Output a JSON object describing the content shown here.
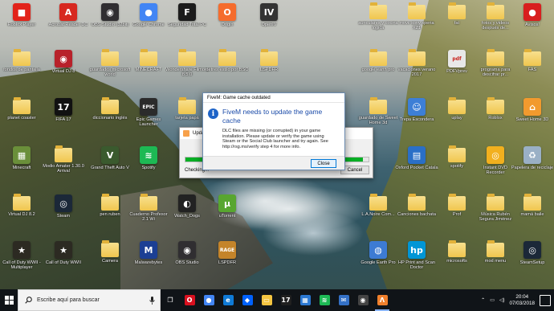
{
  "desktop": {
    "icons": [
      {
        "label": "Roblox Player",
        "glyph": "■",
        "color": "#e2231a",
        "kind": "app"
      },
      {
        "label": "Acrobat Reader DC",
        "glyph": "A",
        "color": "#d7281f",
        "kind": "app"
      },
      {
        "label": "OBS Studio (32bit)",
        "glyph": "◉",
        "color": "#302e31",
        "kind": "app"
      },
      {
        "label": "Google Chrome",
        "glyph": "●",
        "color": "#4285f4",
        "kind": "app"
      },
      {
        "label": "Seguridad Total PC",
        "glyph": "F",
        "color": "#1c1c1c",
        "kind": "app"
      },
      {
        "label": "Origin",
        "glyph": "O",
        "color": "#f56c2d",
        "kind": "app"
      },
      {
        "label": "OpenIV",
        "glyph": "IV",
        "color": "#333333",
        "kind": "app"
      },
      {
        "label": "fondos de pantalla",
        "kind": "folder"
      },
      {
        "label": "Virtual DJ 8",
        "glyph": "◉",
        "color": "#b8212a",
        "kind": "app"
      },
      {
        "label": "guardados microsoft world",
        "kind": "folder"
      },
      {
        "label": "MINECRAFT",
        "kind": "folder"
      },
      {
        "label": "Wondershare Filmora 8.5.0",
        "kind": "folder"
      },
      {
        "label": "detres estilo por BSO",
        "kind": "folder"
      },
      {
        "label": "LSPDFR",
        "kind": "folder"
      },
      {
        "label": "planet coaster",
        "kind": "folder"
      },
      {
        "label": "FIFA 17",
        "glyph": "17",
        "color": "#111111",
        "kind": "app"
      },
      {
        "label": "diccionario inglés",
        "kind": "folder"
      },
      {
        "label": "Epic Games Launcher",
        "glyph": "EPIC",
        "color": "#2b2b2b",
        "kind": "app"
      },
      {
        "label": "tarjeta papá",
        "kind": "folder"
      },
      {
        "label": "Minecraft",
        "glyph": "▦",
        "color": "#6a8f3a",
        "kind": "app"
      },
      {
        "label": "Modio Amater 1.30.0 Arrival",
        "kind": "folder"
      },
      {
        "label": "Grand Theft Auto V",
        "glyph": "V",
        "color": "#3a5a2e",
        "kind": "app"
      },
      {
        "label": "Spotify",
        "glyph": "≋",
        "color": "#1db954",
        "kind": "app"
      },
      {
        "label": "Virtual DJ 8.2",
        "kind": "folder"
      },
      {
        "label": "Steam",
        "glyph": "◎",
        "color": "#1b2838",
        "kind": "app"
      },
      {
        "label": "pen ruben",
        "kind": "folder"
      },
      {
        "label": "Cuaderno Profesor 2.1 Wi",
        "kind": "folder"
      },
      {
        "label": "Watch_Dogs",
        "glyph": "◐",
        "color": "#222222",
        "kind": "app"
      },
      {
        "label": "uTorrent",
        "glyph": "µ",
        "color": "#58a630",
        "kind": "app"
      },
      {
        "label": "Call of Duty WWII - Multiplayer",
        "glyph": "★",
        "color": "#2c2a22",
        "kind": "app"
      },
      {
        "label": "Call of Duty WWII",
        "glyph": "★",
        "color": "#2c2a22",
        "kind": "app"
      },
      {
        "label": "Camera",
        "kind": "folder"
      },
      {
        "label": "Malwarebytes",
        "glyph": "M",
        "color": "#1c3f94",
        "kind": "app"
      },
      {
        "label": "OBS Studio",
        "glyph": "◉",
        "color": "#302e31",
        "kind": "app"
      },
      {
        "label": "LSPDFR",
        "glyph": "RAGE",
        "color": "#c4842a",
        "kind": "app"
      },
      {
        "label": "auriculares y cocina lógica",
        "kind": "folder"
      },
      {
        "label": "movil sony xperia XZ1",
        "kind": "folder"
      },
      {
        "label": "fat",
        "kind": "folder"
      },
      {
        "label": "fotos y videos después de...",
        "kind": "folder"
      },
      {
        "label": "Avisos!",
        "glyph": "●",
        "color": "#d81e1e",
        "kind": "app"
      },
      {
        "label": "google earth pro",
        "kind": "folder"
      },
      {
        "label": "vacaciones verano 2017",
        "kind": "folder"
      },
      {
        "label": "PDFVprev",
        "glyph": "pdf",
        "color": "#e8e8e8",
        "kind": "doc"
      },
      {
        "label": "programa para descifrar pr...",
        "kind": "folder"
      },
      {
        "label": "FAS",
        "kind": "folder"
      },
      {
        "label": "guardado de Sweet Home 3d",
        "kind": "folder"
      },
      {
        "label": "Trepa Escondera",
        "glyph": "☺",
        "color": "#3d7fd6",
        "kind": "app"
      },
      {
        "label": "uplay",
        "kind": "folder"
      },
      {
        "label": "Roblox",
        "kind": "folder"
      },
      {
        "label": "Sweet Home 3D",
        "glyph": "⌂",
        "color": "#f29a2e",
        "kind": "app"
      },
      {
        "label": "Oxford Pocket Catala",
        "glyph": "▤",
        "color": "#2a6fc7",
        "kind": "app"
      },
      {
        "label": "spotify",
        "kind": "folder"
      },
      {
        "label": "Instant DVD Recorder",
        "glyph": "◎",
        "color": "#f2b01e",
        "kind": "app"
      },
      {
        "label": "Papelera de reciclaje",
        "glyph": "♻",
        "color": "#9ab0c6",
        "kind": "app"
      },
      {
        "label": "L.A.Noire Com...",
        "kind": "folder"
      },
      {
        "label": "Canciones bachata",
        "kind": "folder"
      },
      {
        "label": "Prof",
        "kind": "folder"
      },
      {
        "label": "Música Rubén Segura Jiménez",
        "kind": "folder"
      },
      {
        "label": "mamá baile",
        "kind": "folder"
      },
      {
        "label": "Google Earth Pro",
        "glyph": "◍",
        "color": "#3d7bd3",
        "kind": "app"
      },
      {
        "label": "HP Print and Scan Doctor",
        "glyph": "hp",
        "color": "#0096d6",
        "kind": "app"
      },
      {
        "label": "microsofts",
        "kind": "folder"
      },
      {
        "label": "mod menu",
        "kind": "folder"
      },
      {
        "label": "SteamSetup",
        "glyph": "◎",
        "color": "#1b2838",
        "kind": "app"
      }
    ]
  },
  "updater_window": {
    "title": "Updating...",
    "status": "Checking...",
    "cancel_label": "Cancel",
    "progress": 0.97
  },
  "dialog": {
    "title": "FiveM: Game cache outdated",
    "heading": "FiveM needs to update the game cache",
    "message": "DLC files are missing (or corrupted) in your game installation. Please update or verify the game using Steam or the Social Club launcher and try again. See http://rsg.ms/verify step 4 for more info.",
    "close_label": "Close"
  },
  "taskbar": {
    "search_placeholder": "Escribe aquí para buscar",
    "apps": [
      {
        "name": "task-view-icon",
        "glyph": "❐",
        "color": "#101418"
      },
      {
        "name": "opera-icon",
        "glyph": "O",
        "color": "#d9101f"
      },
      {
        "name": "chrome-icon",
        "glyph": "●",
        "color": "#4285f4"
      },
      {
        "name": "edge-icon",
        "glyph": "e",
        "color": "#0f7ad6"
      },
      {
        "name": "dropbox-icon",
        "glyph": "◆",
        "color": "#0061fe"
      },
      {
        "name": "file-explorer-icon",
        "glyph": "▭",
        "color": "#f4c541"
      },
      {
        "name": "fifa-icon",
        "glyph": "17",
        "color": "#202020"
      },
      {
        "name": "store-icon",
        "glyph": "▦",
        "color": "#2b78d2"
      },
      {
        "name": "spotify-icon",
        "glyph": "≋",
        "color": "#1db954"
      },
      {
        "name": "mail-icon",
        "glyph": "✉",
        "color": "#3471c6"
      },
      {
        "name": "obs-icon",
        "glyph": "◉",
        "color": "#444444"
      },
      {
        "name": "fivem-icon",
        "glyph": "Λ",
        "color": "#f0802c"
      }
    ],
    "time": "20:04",
    "date": "07/03/2018"
  }
}
